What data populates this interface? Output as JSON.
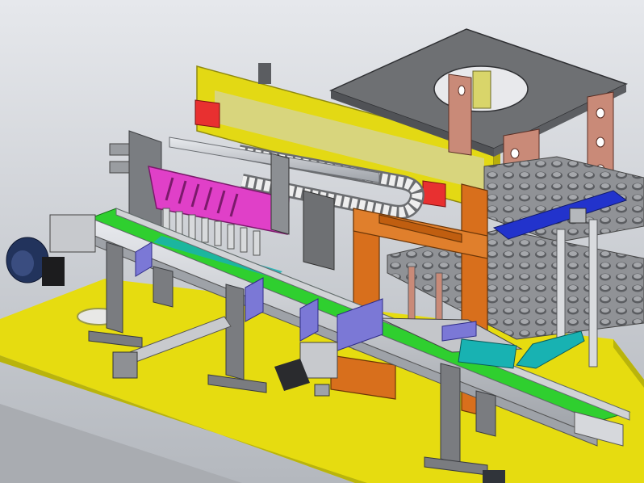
{
  "scene": {
    "subject": "cad-assembly-automated-conveyor-pick-and-place-station",
    "colors": {
      "background_top": "#e4e6ea",
      "background_bottom": "#b8bcc2",
      "table_top": "#e6dc10",
      "table_edge": "#b9b40c",
      "frame_yellow": "#e3d914",
      "frame_yellow_dark": "#b8ad0c",
      "steel_plate": "#6e7073",
      "steel_plate_light": "#8c8f93",
      "belt_green": "#2fcf2f",
      "rail_silver": "#c9ccd0",
      "bracket_purple": "#7b78d6",
      "gripper_magenta": "#e040c8",
      "post_copper": "#c98a78",
      "frame_orange": "#d86f1c",
      "tray_gray": "#8e9094",
      "bracket_blue": "#2233cc",
      "motor_blue": "#22335c",
      "stop_red": "#e83030",
      "chute_cyan": "#18b2b2",
      "chain_white": "#eeeeee",
      "leg_gray": "#7a7c80"
    },
    "icons": [
      "servo-motor-icon",
      "cable-chain-icon",
      "gripper-array-icon",
      "tray-stack-icon"
    ]
  }
}
